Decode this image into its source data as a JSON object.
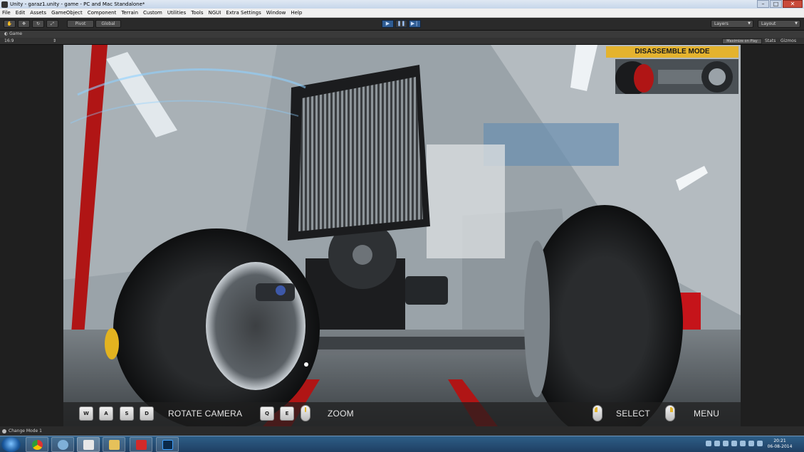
{
  "window": {
    "title": "Unity - garaz1.unity - game - PC and Mac Standalone*"
  },
  "menu": [
    "File",
    "Edit",
    "Assets",
    "GameObject",
    "Component",
    "Terrain",
    "Custom",
    "Utilities",
    "Tools",
    "NGUI",
    "Extra Settings",
    "Window",
    "Help"
  ],
  "toolbar": {
    "pivot_label": "Pivot",
    "global_label": "Global",
    "layers_label": "Layers",
    "layout_label": "Layout"
  },
  "game_panel": {
    "tab_label": "Game",
    "aspect_label": "16:9",
    "maximize_label": "Maximize on Play",
    "stats_label": "Stats",
    "gizmos_label": "Gizmos"
  },
  "hud": {
    "mode_banner": "DISASSEMBLE MODE",
    "keys": [
      "W",
      "A",
      "S",
      "D"
    ],
    "rotate_label": "ROTATE CAMERA",
    "zoom_keys": [
      "Q",
      "E"
    ],
    "zoom_label": "ZOOM",
    "select_label": "SELECT",
    "menu_label": "MENU"
  },
  "status": {
    "message": "Change Mode 1"
  },
  "clock": {
    "time": "20:21",
    "date": "06-08-2014"
  },
  "colors": {
    "accent": "#e4b32e",
    "hud_bg": "#1e1e1e",
    "taskbar": "#1f3f63"
  }
}
